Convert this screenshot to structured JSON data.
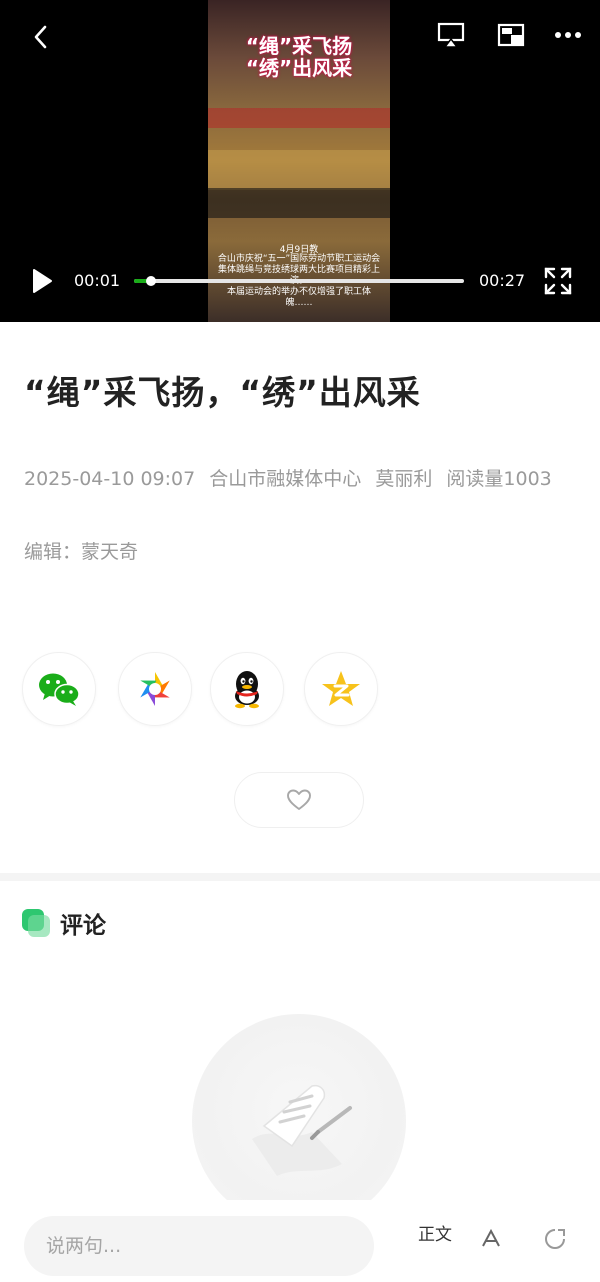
{
  "player": {
    "current_time": "00:01",
    "total_time": "00:27",
    "progress": 0.05,
    "video_title_line1": "“绳”采飞扬",
    "video_title_line2": "“绣”出风采",
    "video_caption_date": "4月9日教",
    "video_caption": "合山市庆祝“五一”国际劳动节职工运动会\n集体跳绳与竞技绣球两大比赛项目精彩上演。\n本届运动会的举办不仅增强了职工体魄……",
    "accent_color": "#1aad19"
  },
  "article": {
    "title": "“绳”采飞扬，“绣”出风采",
    "date": "2025-04-10 09:07",
    "source": "合山市融媒体中心",
    "author": "莫丽利",
    "read_count": "阅读量1003",
    "editor": "编辑：蒙天奇"
  },
  "share": {
    "items": [
      {
        "icon": "wechat-icon"
      },
      {
        "icon": "moments-icon"
      },
      {
        "icon": "qq-icon"
      },
      {
        "icon": "qzone-icon"
      }
    ]
  },
  "comments": {
    "title": "评论",
    "accent_color": "#2ec770"
  },
  "bottom_bar": {
    "placeholder": "说两句...",
    "text_size_label": "正文"
  }
}
